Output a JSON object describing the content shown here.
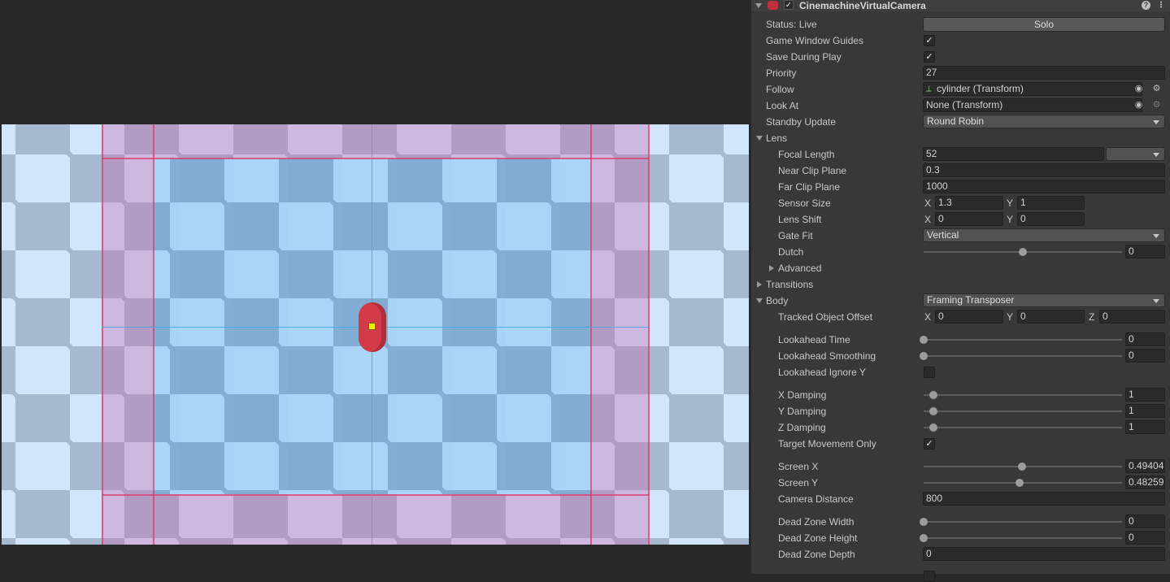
{
  "component": {
    "title": "CinemachineVirtualCamera",
    "enabled_mark": "✓",
    "help_icon": "question-icon",
    "menu_icon": "kebab-menu-icon"
  },
  "status": {
    "label": "Status: Live",
    "solo_label": "Solo"
  },
  "rows": {
    "game_window_guides": {
      "label": "Game Window Guides",
      "checked": "✓"
    },
    "save_during_play": {
      "label": "Save During Play",
      "checked": "✓"
    },
    "priority": {
      "label": "Priority",
      "value": "27"
    },
    "follow": {
      "label": "Follow",
      "value": "cylinder (Transform)",
      "icon": "transform-axes-icon"
    },
    "look_at": {
      "label": "Look At",
      "value": "None (Transform)"
    },
    "standby_update": {
      "label": "Standby Update",
      "value": "Round Robin"
    }
  },
  "lens": {
    "label": "Lens",
    "focal_length": {
      "label": "Focal Length",
      "value": "52",
      "preset": ""
    },
    "near_clip": {
      "label": "Near Clip Plane",
      "value": "0.3"
    },
    "far_clip": {
      "label": "Far Clip Plane",
      "value": "1000"
    },
    "sensor_size": {
      "label": "Sensor Size",
      "x_label": "X",
      "x": "1.3",
      "y_label": "Y",
      "y": "1"
    },
    "lens_shift": {
      "label": "Lens Shift",
      "x_label": "X",
      "x": "0",
      "y_label": "Y",
      "y": "0"
    },
    "gate_fit": {
      "label": "Gate Fit",
      "value": "Vertical"
    },
    "dutch": {
      "label": "Dutch",
      "value": "0",
      "level": 0.5
    },
    "advanced": {
      "label": "Advanced"
    }
  },
  "transitions": {
    "label": "Transitions"
  },
  "body": {
    "label": "Body",
    "value": "Framing Transposer",
    "tracked_offset": {
      "label": "Tracked Object Offset",
      "x_label": "X",
      "x": "0",
      "y_label": "Y",
      "y": "0",
      "z_label": "Z",
      "z": "0"
    },
    "lookahead_time": {
      "label": "Lookahead Time",
      "value": "0",
      "level": 0
    },
    "lookahead_smoothing": {
      "label": "Lookahead Smoothing",
      "value": "0",
      "level": 0
    },
    "lookahead_ignore_y": {
      "label": "Lookahead Ignore Y",
      "checked": ""
    },
    "x_damping": {
      "label": "X Damping",
      "value": "1",
      "level": 0.05
    },
    "y_damping": {
      "label": "Y Damping",
      "value": "1",
      "level": 0.05
    },
    "z_damping": {
      "label": "Z Damping",
      "value": "1",
      "level": 0.05
    },
    "target_movement_only": {
      "label": "Target Movement Only",
      "checked": "✓"
    },
    "screen_x": {
      "label": "Screen X",
      "value": "0.49404",
      "level": 0.494
    },
    "screen_y": {
      "label": "Screen Y",
      "value": "0.48259",
      "level": 0.483
    },
    "camera_distance": {
      "label": "Camera Distance",
      "value": "800"
    },
    "dead_zone_width": {
      "label": "Dead Zone Width",
      "value": "0",
      "level": 0
    },
    "dead_zone_height": {
      "label": "Dead Zone Height",
      "value": "0",
      "level": 0
    },
    "dead_zone_depth": {
      "label": "Dead Zone Depth",
      "value": "0"
    }
  },
  "colors": {
    "target": "#d23a48",
    "soft_zone": "#c86eb4",
    "dead_zone_guides": "#dc3c6e",
    "center_guides": "#46aae6",
    "target_point": "#f2f000"
  }
}
